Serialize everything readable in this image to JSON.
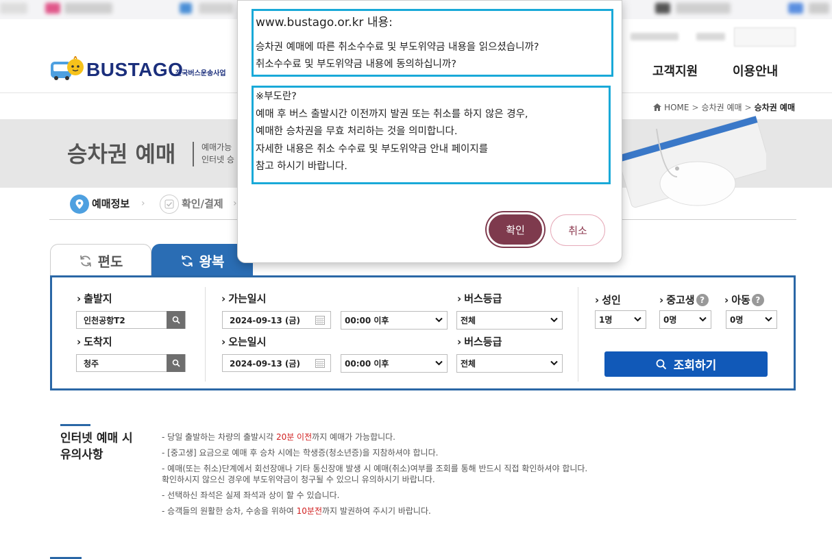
{
  "header": {
    "logo_text": "BUSTAGO",
    "logo_sub": "전국버스운송사업",
    "nav": [
      {
        "label": "고객지원"
      },
      {
        "label": "이용안내"
      }
    ]
  },
  "breadcrumb": [
    "HOME",
    "승차권 예매",
    "승차권 예매"
  ],
  "title": {
    "heading": "승차권 예매",
    "desc_line1": "예매가능",
    "desc_line2": "인터넷 승"
  },
  "steps": [
    {
      "label": "예매정보",
      "active": true
    },
    {
      "label": "확인/결제",
      "active": false
    }
  ],
  "tabs": {
    "oneway": "편도",
    "roundtrip": "왕복"
  },
  "search": {
    "departure_label": "출발지",
    "departure_value": "인천공항T2",
    "arrival_label": "도착지",
    "arrival_value": "청주",
    "go_date_label": "가는일시",
    "go_date": "2024-09-13 (금)",
    "go_time": "00:00 이후",
    "return_date_label": "오는일시",
    "return_date": "2024-09-13 (금)",
    "return_time": "00:00 이후",
    "grade_label": "버스등급",
    "grade_go": "전체",
    "grade_return": "전체",
    "adult_label": "성인",
    "adult_value": "1명",
    "student_label": "중고생",
    "student_value": "0명",
    "child_label": "아동",
    "child_value": "0명",
    "help_glyph": "?",
    "submit_label": "조회하기"
  },
  "notice": {
    "title": "인터넷 예매 시\n유의사항",
    "items": [
      {
        "pre": "당일 출발하는 차량의 출발시각 ",
        "hl": "20분 이전",
        "post": "까지 예매가 가능합니다."
      },
      {
        "pre": "[중고생] 요금으로 예매 후 승차 시에는 학생증(청소년증)을 지참하셔야 합니다.",
        "hl": "",
        "post": ""
      },
      {
        "pre": "예매(또는 취소)단계에서 회선장애나 기타 통신장애 발생 시 예매(취소)여부를 조회를 통해 반드시 직접 확인하셔야 합니다.\n  확인하시지 않으신 경우에 부도위약금이 청구될 수 있으니 유의하시기 바랍니다.",
        "hl": "",
        "post": ""
      },
      {
        "pre": "선택하신 좌석은 실제 좌석과 상이 할 수 있습니다.",
        "hl": "",
        "post": ""
      },
      {
        "pre": "승객들의 원활한 승차, 수송을 위하여 ",
        "hl": "10분전",
        "post": "까지 발권하여 주시기 바랍니다."
      }
    ]
  },
  "dialog": {
    "origin": "www.bustago.or.kr 내용:",
    "question_line1": "승차권 예매에 따른 취소수수료 및 부도위약금 내용을 읽으셨습니까?",
    "question_line2": "취소수수료 및 부도위약금 내용에 동의하십니까?",
    "body_lines": [
      "※부도란?",
      "예매 후 버스 출발시간 이전까지 발권 또는 취소를 하지 않은 경우,",
      "예매한 승차권을 무효 처리하는 것을 의미합니다.",
      "자세한 내용은 취소 수수료 및 부도위약금 안내 페이지를",
      "참고 하시기 바랍니다."
    ],
    "ok_label": "확인",
    "cancel_label": "취소"
  },
  "colors": {
    "brand_blue": "#1159b8",
    "tab_blue": "#2a6db4",
    "dialog_highlight": "#19a9d8",
    "ok_button": "#7e3a4d",
    "notice_red": "#d12020"
  }
}
